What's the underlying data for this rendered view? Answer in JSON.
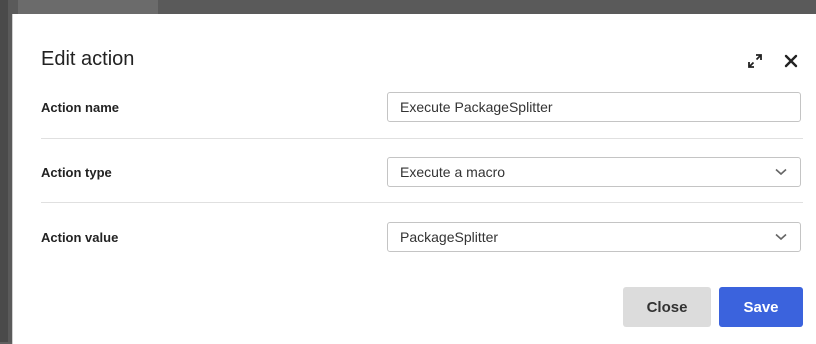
{
  "dialog": {
    "title": "Edit action",
    "icons": {
      "expand": "expand-icon",
      "close": "close-icon"
    }
  },
  "form": {
    "action_name": {
      "label": "Action name",
      "value": "Execute PackageSplitter"
    },
    "action_type": {
      "label": "Action type",
      "selected": "Execute a macro"
    },
    "action_value": {
      "label": "Action value",
      "selected": "PackageSplitter"
    }
  },
  "buttons": {
    "close_label": "Close",
    "save_label": "Save"
  },
  "colors": {
    "primary": "#3b63dd",
    "secondary_button": "#dcdcdc",
    "backdrop": "#5a5a5a"
  }
}
